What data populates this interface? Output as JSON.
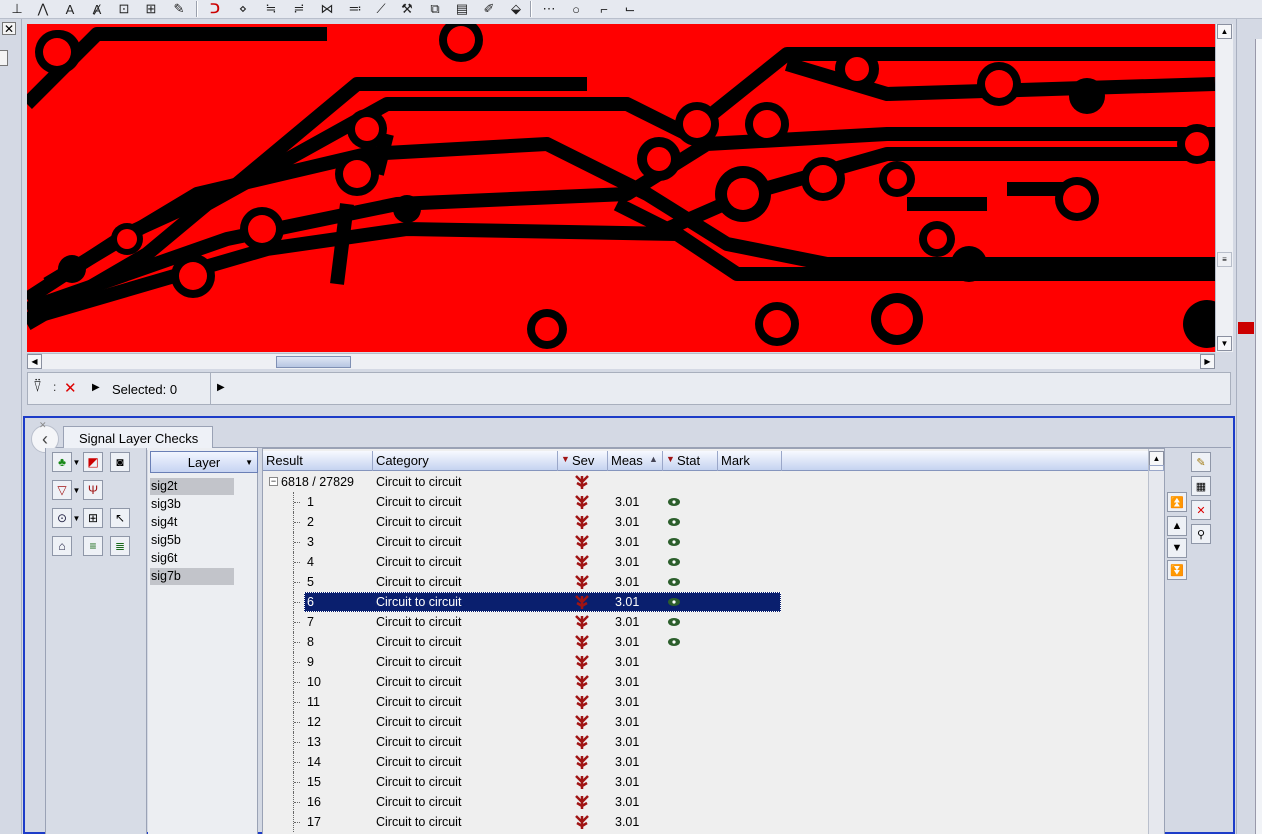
{
  "toolbar": {
    "icons": [
      "text-icon",
      "compass-icon",
      "text-frame-icon",
      "text-bold-icon",
      "text-box-icon",
      "text-align-icon",
      "text-edit-icon",
      "magnet-icon",
      "connect-icon",
      "route-icon",
      "route-multi-icon",
      "route-fanout-icon",
      "route-diff-icon",
      "route-tool-icon",
      "wrench-icon",
      "copy-icon",
      "properties-icon",
      "edit-icon",
      "stamp-icon",
      "select-icon",
      "zoom-icon",
      "copy-region-icon",
      "paste-region-icon"
    ]
  },
  "status_bar": {
    "selected_label": "Selected: 0"
  },
  "panel": {
    "tab_label": "Signal Layer Checks",
    "layer_header": "Layer",
    "layers": [
      "sig2t",
      "sig3b",
      "sig4t",
      "sig5b",
      "sig6t",
      "sig7b"
    ],
    "selected_layers": [
      0,
      5
    ],
    "columns": [
      "Result",
      "Category",
      "Sev",
      "Meas",
      "Stat",
      "Mark"
    ],
    "root_row": {
      "result": "6818 / 27829",
      "category": "Circuit to circuit"
    },
    "rows": [
      {
        "result": "1",
        "category": "Circuit to circuit",
        "meas": "3.01",
        "stat": true
      },
      {
        "result": "2",
        "category": "Circuit to circuit",
        "meas": "3.01",
        "stat": true
      },
      {
        "result": "3",
        "category": "Circuit to circuit",
        "meas": "3.01",
        "stat": true
      },
      {
        "result": "4",
        "category": "Circuit to circuit",
        "meas": "3.01",
        "stat": true
      },
      {
        "result": "5",
        "category": "Circuit to circuit",
        "meas": "3.01",
        "stat": true
      },
      {
        "result": "6",
        "category": "Circuit to circuit",
        "meas": "3.01",
        "stat": true
      },
      {
        "result": "7",
        "category": "Circuit to circuit",
        "meas": "3.01",
        "stat": true
      },
      {
        "result": "8",
        "category": "Circuit to circuit",
        "meas": "3.01",
        "stat": true
      },
      {
        "result": "9",
        "category": "Circuit to circuit",
        "meas": "3.01",
        "stat": false
      },
      {
        "result": "10",
        "category": "Circuit to circuit",
        "meas": "3.01",
        "stat": false
      },
      {
        "result": "11",
        "category": "Circuit to circuit",
        "meas": "3.01",
        "stat": false
      },
      {
        "result": "12",
        "category": "Circuit to circuit",
        "meas": "3.01",
        "stat": false
      },
      {
        "result": "13",
        "category": "Circuit to circuit",
        "meas": "3.01",
        "stat": false
      },
      {
        "result": "14",
        "category": "Circuit to circuit",
        "meas": "3.01",
        "stat": false
      },
      {
        "result": "15",
        "category": "Circuit to circuit",
        "meas": "3.01",
        "stat": false
      },
      {
        "result": "16",
        "category": "Circuit to circuit",
        "meas": "3.01",
        "stat": false
      },
      {
        "result": "17",
        "category": "Circuit to circuit",
        "meas": "3.01",
        "stat": false
      }
    ],
    "selected_row": 5
  },
  "colors": {
    "copper": "#ff0000",
    "substrate": "#000000",
    "selection": "#0a1f6e",
    "panel_border": "#1d3cc8",
    "severity": "#a01414",
    "status_eye": "#2c5e2c"
  }
}
